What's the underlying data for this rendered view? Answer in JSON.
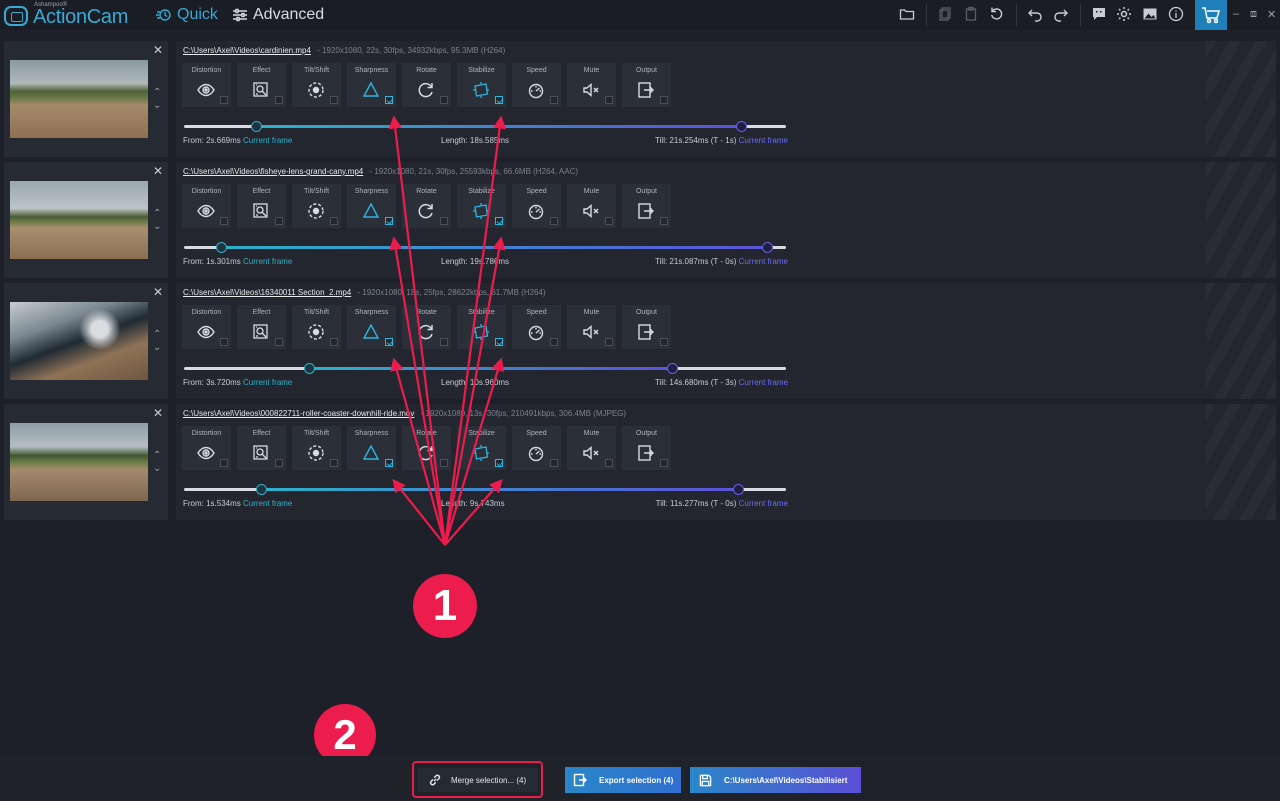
{
  "app": {
    "brand_small": "Ashampoo®",
    "brand": "ActionCam",
    "mode_quick": "Quick",
    "mode_advanced": "Advanced"
  },
  "tool_labels": [
    "Distortion",
    "Effect",
    "Tilt/Shift",
    "Sharpness",
    "Rotate",
    "Stabilize",
    "Speed",
    "Mute",
    "Output"
  ],
  "tool_icons": [
    "eye-icon",
    "effect-icon",
    "tilt-shift-icon",
    "sharpness-triangle-icon",
    "rotate-icon",
    "stabilize-icon",
    "speed-gauge-icon",
    "mute-icon",
    "output-icon"
  ],
  "clips": [
    {
      "path": "C:\\Users\\Axel\\Videos\\cardinien.mp4",
      "meta": "-   1920x1080, 22s, 30fps, 34932kbps, 95.3MB (H264)",
      "from": "From: 2s.669ms",
      "current_frame": "Current frame",
      "length": "Length: 18s.585ms",
      "till": "Till: 21s.254ms (T - 1s)",
      "checked": [
        false,
        false,
        false,
        true,
        false,
        true,
        false,
        false,
        false
      ],
      "start_frac": 0.12,
      "end_frac": 0.925
    },
    {
      "path": "C:\\Users\\Axel\\Videos\\fisheye-lens-grand-cany.mp4",
      "meta": "-   1920x1080, 21s, 30fps, 25593kbps, 66.6MB (H264, AAC)",
      "from": "From: 1s.301ms",
      "current_frame": "Current frame",
      "length": "Length: 19s.786ms",
      "till": "Till: 21s.087ms (T - 0s)",
      "checked": [
        false,
        false,
        false,
        true,
        false,
        true,
        false,
        false,
        false
      ],
      "start_frac": 0.062,
      "end_frac": 0.968
    },
    {
      "path": "C:\\Users\\Axel\\Videos\\16340011 Section_2.mp4",
      "meta": "-   1920x1080, 18s, 25fps, 28622kbps, 61.7MB (H264)",
      "from": "From: 3s.720ms",
      "current_frame": "Current frame",
      "length": "Length: 10s.960ms",
      "till": "Till: 14s.680ms (T - 3s)",
      "checked": [
        false,
        false,
        false,
        true,
        false,
        true,
        false,
        false,
        false
      ],
      "start_frac": 0.207,
      "end_frac": 0.81
    },
    {
      "path": "C:\\Users\\Axel\\Videos\\000822711-roller-coaster-downhill-ride.mov",
      "meta": "-   1920x1080, 13s, 30fps, 210491kbps, 306.4MB (MJPEG)",
      "from": "From: 1s.534ms",
      "current_frame": "Current frame",
      "length": "Length: 9s.743ms",
      "till": "Till: 11s.277ms (T - 0s)",
      "checked": [
        false,
        false,
        false,
        true,
        false,
        true,
        false,
        false,
        false
      ],
      "start_frac": 0.128,
      "end_frac": 0.92
    }
  ],
  "annotations": {
    "badge1": "1",
    "badge2": "2"
  },
  "footer": {
    "merge_label": "Merge selection... (4)",
    "export_label": "Export selection (4)",
    "output_path": "C:\\Users\\Axel\\Videos\\Stabilisiert"
  },
  "colors": {
    "accent": "#2ab3c9",
    "violet": "#6a6cf0",
    "annotation": "#ec1c4d"
  }
}
